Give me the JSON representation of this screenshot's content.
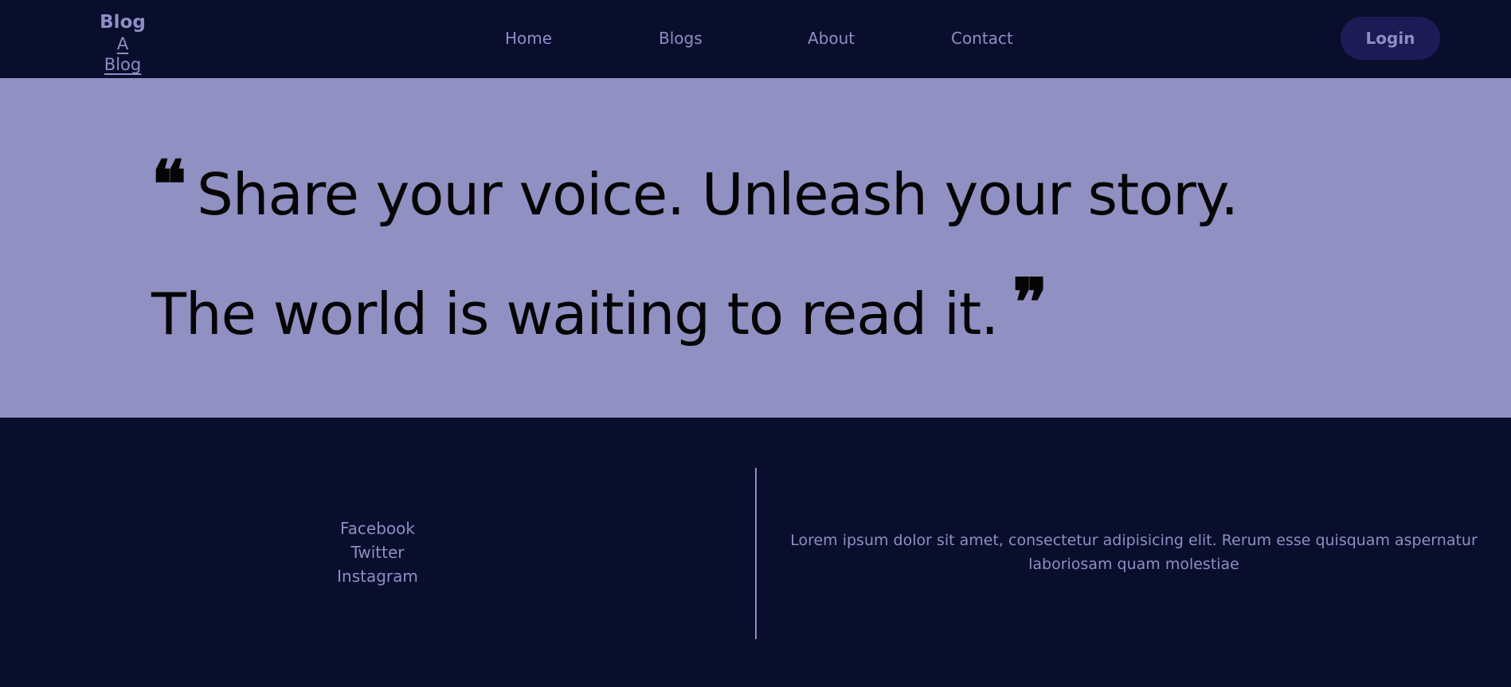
{
  "header": {
    "brand_title": "Blog",
    "brand_subtitle": "A Blog",
    "nav": {
      "home": "Home",
      "blogs": "Blogs",
      "about": "About",
      "contact": "Contact"
    },
    "login_label": "Login"
  },
  "hero": {
    "open_quote": "❝",
    "line1": "Share your voice. Unleash your story.",
    "line2": "The world is waiting to read it.",
    "close_quote": "❞"
  },
  "footer": {
    "social": {
      "facebook": "Facebook",
      "twitter": "Twitter",
      "instagram": "Instagram"
    },
    "description": "Lorem ipsum dolor sit amet, consectetur adipisicing elit. Rerum esse quisquam aspernatur laboriosam quam molestiae"
  },
  "colors": {
    "background_dark": "#080e2c",
    "hero_background": "#9190c3",
    "accent_text": "#8f8ec3",
    "button_background": "#1d1b55",
    "quote_text": "#050505"
  },
  "icons": {
    "open_quote": "quote-open-icon",
    "close_quote": "quote-close-icon"
  }
}
